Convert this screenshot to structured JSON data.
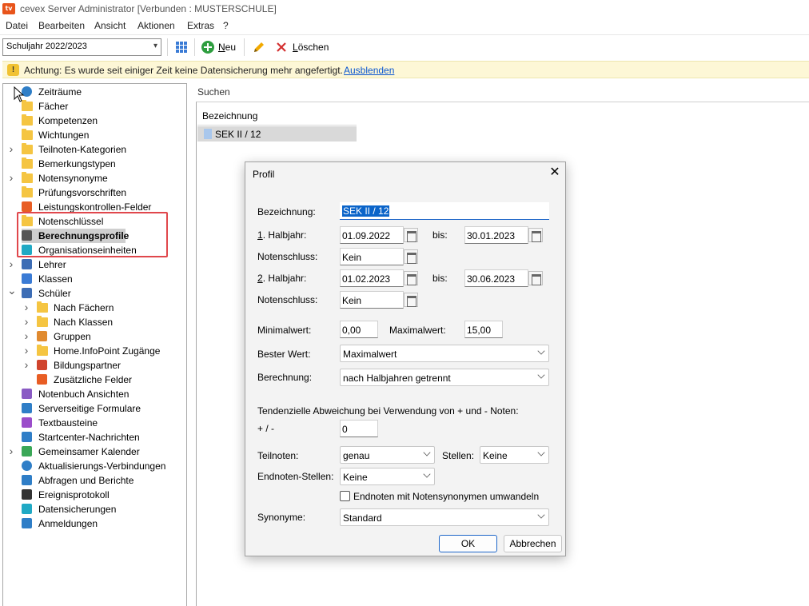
{
  "window": {
    "title": "cevex Server Administrator [Verbunden : MUSTERSCHULE]",
    "app_icon": "tv"
  },
  "menu": [
    "Datei",
    "Bearbeiten",
    "Ansicht",
    "Aktionen",
    "Extras",
    "?"
  ],
  "toolbar": {
    "year_select": "Schuljahr 2022/2023",
    "new_label_rest": "eu",
    "new_label_key": "N",
    "delete_label_key": "L",
    "delete_label_rest": "öschen"
  },
  "warning": {
    "text": "Achtung: Es wurde seit einiger Zeit keine Datensicherung mehr angefertigt.",
    "link": "Ausblenden"
  },
  "tree": {
    "items": [
      {
        "label": "Zeiträume",
        "icon": "clock-icon"
      },
      {
        "label": "Fächer",
        "icon": "folder-icon"
      },
      {
        "label": "Kompetenzen",
        "icon": "folder-icon"
      },
      {
        "label": "Wichtungen",
        "icon": "folder-icon"
      },
      {
        "label": "Teilnoten-Kategorien",
        "icon": "folder-icon"
      },
      {
        "label": "Bemerkungstypen",
        "icon": "folder-icon"
      },
      {
        "label": "Notensynonyme",
        "icon": "folder-icon"
      },
      {
        "label": "Prüfungsvorschriften",
        "icon": "folder-icon"
      },
      {
        "label": "Leistungskontrollen-Felder",
        "icon": "tag-icon"
      },
      {
        "label": "Notenschlüssel",
        "icon": "folder-icon"
      },
      {
        "label": "Berechnungsprofile",
        "icon": "calculator-icon"
      },
      {
        "label": "Organisationseinheiten",
        "icon": "org-icon"
      },
      {
        "label": "Lehrer",
        "icon": "teacher-icon"
      },
      {
        "label": "Klassen",
        "icon": "class-icon"
      },
      {
        "label": "Schüler",
        "icon": "student-icon"
      },
      {
        "label": "Nach Fächern",
        "icon": "folder-icon"
      },
      {
        "label": "Nach Klassen",
        "icon": "folder-icon"
      },
      {
        "label": "Gruppen",
        "icon": "group-icon"
      },
      {
        "label": "Home.InfoPoint Zugänge",
        "icon": "folder-icon"
      },
      {
        "label": "Bildungspartner",
        "icon": "factory-icon"
      },
      {
        "label": "Zusätzliche Felder",
        "icon": "tag-icon"
      },
      {
        "label": "Notenbuch Ansichten",
        "icon": "view-icon"
      },
      {
        "label": "Serverseitige Formulare",
        "icon": "form-icon"
      },
      {
        "label": "Textbausteine",
        "icon": "text-icon"
      },
      {
        "label": "Startcenter-Nachrichten",
        "icon": "mail-icon"
      },
      {
        "label": "Gemeinsamer Kalender",
        "icon": "calendar-icon"
      },
      {
        "label": "Aktualisierungs-Verbindungen",
        "icon": "sync-icon"
      },
      {
        "label": "Abfragen und Berichte",
        "icon": "report-icon"
      },
      {
        "label": "Ereignisprotokoll",
        "icon": "log-icon"
      },
      {
        "label": "Datensicherungen",
        "icon": "backup-icon"
      },
      {
        "label": "Anmeldungen",
        "icon": "login-icon"
      }
    ]
  },
  "main": {
    "search_label": "Suchen",
    "column_header": "Bezeichnung",
    "row": "SEK II / 12"
  },
  "dialog": {
    "title": "Profil",
    "bezeichnung_label": "Bezeichnung:",
    "bezeichnung_value": "SEK II / 12",
    "h1_label_key": "1",
    "h1_label_rest": ". Halbjahr:",
    "h1_from": "01.09.2022",
    "bis_label": "bis:",
    "h1_to": "30.01.2023",
    "notenschluss_label": "Notenschluss:",
    "notenschluss1": "Kein",
    "h2_label_key": "2",
    "h2_label_rest": ". Halbjahr:",
    "h2_from": "01.02.2023",
    "h2_to": "30.06.2023",
    "notenschluss2": "Kein",
    "min_label": "Minimalwert:",
    "min_value": "0,00",
    "max_label": "Maximalwert:",
    "max_value": "15,00",
    "best_label": "Bester Wert:",
    "best_value": "Maximalwert",
    "calc_label": "Berechnung:",
    "calc_value": "nach Halbjahren getrennt",
    "tendency_label": "Tendenzielle Abweichung bei Verwendung von + und - Noten:",
    "plusminus_label": "+ / -",
    "plusminus_value": "0",
    "teilnoten_label": "Teilnoten:",
    "teilnoten_value": "genau",
    "stellen_label": "Stellen:",
    "stellen_value": "Keine",
    "endnoten_label": "Endnoten-Stellen:",
    "endnoten_value": "Keine",
    "convert_label": "Endnoten mit Notensynonymen umwandeln",
    "synonyme_label": "Synonyme:",
    "synonyme_value": "Standard",
    "ok": "OK",
    "cancel": "Abbrechen"
  },
  "colors": {
    "accent": "#1e66c9",
    "highlight_box": "#e0474c",
    "warning_bg": "#fdf7d6",
    "selection": "#0b64c9"
  }
}
